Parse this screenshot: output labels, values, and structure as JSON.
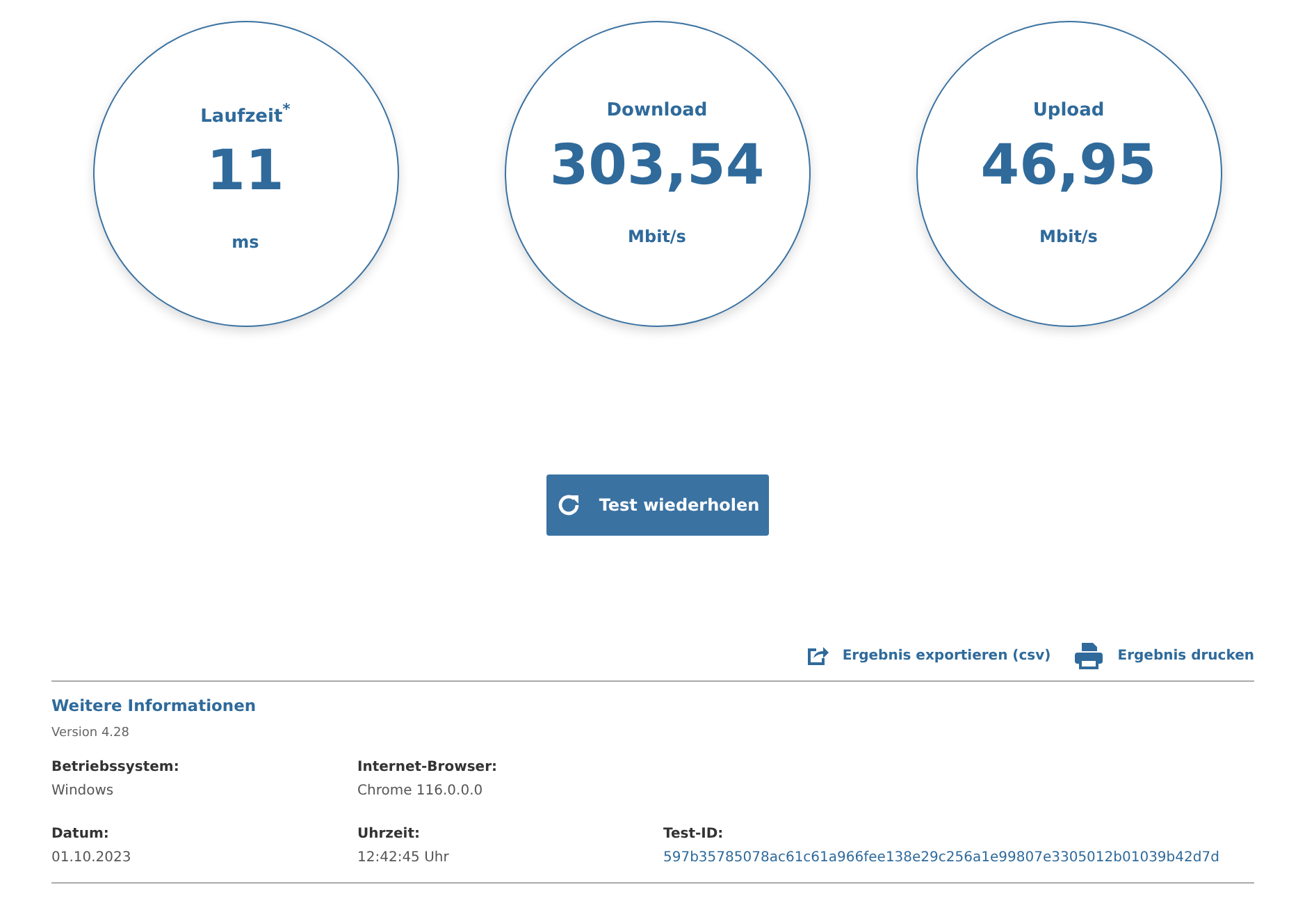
{
  "gauges": [
    {
      "label": "Laufzeit$^{*}$",
      "value": "11",
      "unit": "ms"
    },
    {
      "label": "Download",
      "value": "303,54",
      "unit": "Mbit/s"
    },
    {
      "label": "Upload",
      "value": "46,95",
      "unit": "Mbit/s"
    }
  ],
  "repeat_button": "Test wiederholen",
  "actions": [
    {
      "kind": "export",
      "label": "Ergebnis exportieren (csv)"
    },
    {
      "kind": "print",
      "label": "Ergebnis drucken"
    }
  ],
  "info": {
    "title": "Weitere Informationen",
    "version": "Version 4.28",
    "rows": [
      [
        {
          "label": "Betriebssystem:",
          "value": "Windows",
          "kind": "plain"
        },
        {
          "label": "Internet-Browser:",
          "value": "Chrome 116.0.0.0",
          "kind": "plain"
        }
      ],
      [
        {
          "label": "Datum:",
          "value": "01.10.2023",
          "kind": "plain"
        },
        {
          "label": "Uhrzeit:",
          "value": "12:42:45 Uhr",
          "kind": "plain"
        },
        {
          "label": "Test-ID:",
          "value": "597b35785078ac61c61a966fee138e29c256a1e99807e3305012b01039b42d7d",
          "kind": "id"
        }
      ]
    ]
  }
}
